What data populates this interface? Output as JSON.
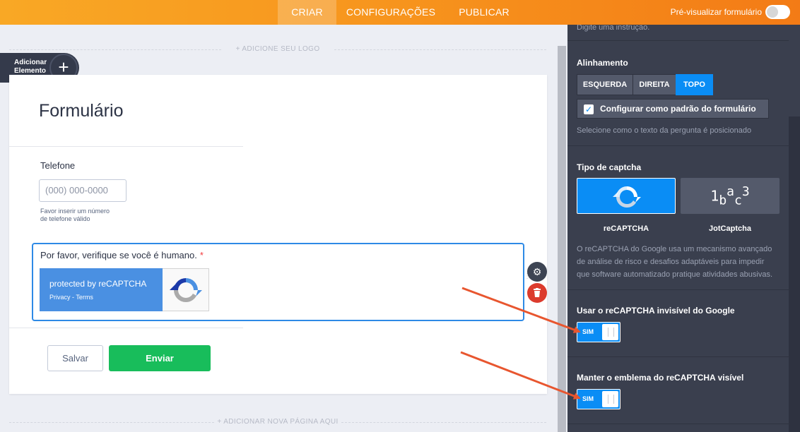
{
  "topbar": {
    "tabs": [
      {
        "label": "CRIAR",
        "active": true
      },
      {
        "label": "CONFIGURAÇÕES",
        "active": false
      },
      {
        "label": "PUBLICAR",
        "active": false
      }
    ],
    "preview_label": "Pré-visualizar formulário",
    "preview_toggle_on": false
  },
  "canvas": {
    "add_logo_hint": "+ ADICIONE SEU LOGO",
    "add_element_label_line1": "Adicionar",
    "add_element_label_line2": "Elemento",
    "form_title": "Formulário",
    "phone": {
      "label": "Telefone",
      "placeholder": "(000) 000-0000",
      "help_line1": "Favor inserir um número",
      "help_line2": "de telefone válido"
    },
    "captcha": {
      "question": "Por favor, verifique se você é humano.",
      "required_mark": "*",
      "badge_title": "protected by reCAPTCHA",
      "badge_links": "Privacy - Terms"
    },
    "save_button": "Salvar",
    "submit_button": "Enviar",
    "add_page_hint": "+ ADICIONAR NOVA PÁGINA AQUI"
  },
  "panel": {
    "top_hint": "Digite uma instrução.",
    "alignment": {
      "title": "Alinhamento",
      "options": [
        "ESQUERDA",
        "DIREITA",
        "TOPO"
      ],
      "selected": "TOPO",
      "default_checkbox_label": "Configurar como padrão do formulário",
      "default_checked": true,
      "hint": "Selecione como o texto da pergunta é posicionado"
    },
    "captcha_type": {
      "title": "Tipo de captcha",
      "options": [
        {
          "label": "reCAPTCHA",
          "icon": "recaptcha-icon",
          "selected": true
        },
        {
          "label": "JotCaptcha",
          "icon": "jotcaptcha-icon",
          "glyph": "1bac3",
          "selected": false
        }
      ],
      "description_lines": [
        "O reCAPTCHA do Google usa um mecanismo avançado",
        "de análise de risco e desafios adaptáveis para impedir",
        "que software automatizado pratique atividades abusivas."
      ]
    },
    "invisible": {
      "title": "Usar o reCAPTCHA invisível do Google",
      "switch_label": "SIM",
      "on": true
    },
    "badge_visible": {
      "title": "Manter o emblema do reCAPTCHA visível",
      "switch_label": "SIM",
      "on": true
    }
  },
  "colors": {
    "topbar_orange": "#f7941d",
    "panel_bg": "#3a3f4e",
    "accent_blue": "#0a8df5",
    "submit_green": "#18bd5b",
    "delete_red": "#dc3b2d",
    "arrow_red": "#e8562f"
  }
}
